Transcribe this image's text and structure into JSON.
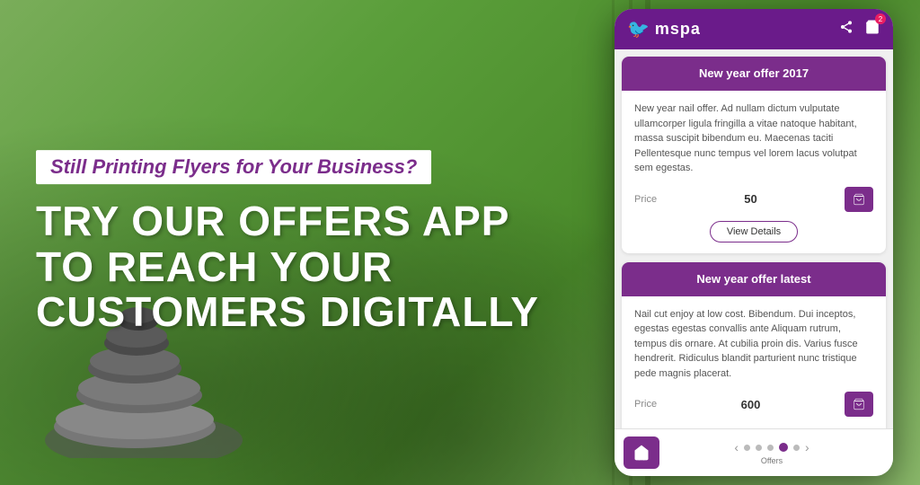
{
  "background": {
    "color": "#6aaa4a"
  },
  "left": {
    "tagline": "Still Printing Flyers for Your Business?",
    "headline_line1": "TRY OUR OFFERS APP TO REACH YOUR",
    "headline_line2": "CUSTOMERS DIGITALLY"
  },
  "phone": {
    "logo_text": "mspa",
    "logo_icon": "🐦",
    "header_share_icon": "share",
    "header_cart_icon": "cart",
    "header_cart_badge": "2",
    "offers": [
      {
        "id": "offer1",
        "title": "New year offer 2017",
        "description": "New year nail offer. Ad nullam dictum vulputate ullamcorper ligula fringilla a vitae natoque habitant, massa suscipit bibendum eu. Maecenas taciti Pellentesque nunc tempus vel lorem lacus volutpat sem egestas.",
        "price_label": "Price",
        "price_value": "50",
        "cart_btn_label": "🛒",
        "view_details_label": "View Details"
      },
      {
        "id": "offer2",
        "title": "New year offer latest",
        "description": "Nail cut enjoy at low cost. Bibendum. Dui inceptos, egestas egestas convallis ante Aliquam rutrum, tempus dis ornare. At cubilia proin dis. Varius fusce hendrerit. Ridiculus blandit parturient nunc tristique pede magnis placerat.",
        "price_label": "Price",
        "price_value": "600",
        "cart_btn_label": "🛒"
      }
    ],
    "nav": {
      "home_icon": "🏠",
      "dots": [
        "dot",
        "dot",
        "dot",
        "dot-active",
        "dot"
      ],
      "nav_label": "Offers"
    }
  }
}
